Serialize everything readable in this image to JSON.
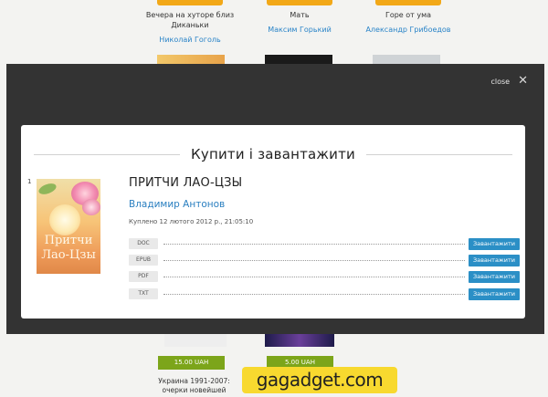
{
  "background": {
    "books_top": [
      {
        "title": "Вечера на хуторе близ Диканьки",
        "author": "Николай Гоголь"
      },
      {
        "title": "Мать",
        "author": "Максим Горький"
      },
      {
        "title": "Горе от ума",
        "author": "Александр Грибоедов"
      }
    ],
    "prices": [
      "15.00 UAH",
      "5.00 UAH"
    ],
    "lower_title": "Украина 1991-2007: очерки новейшей"
  },
  "dialog": {
    "close_label": "close",
    "title": "Купити і завантажити",
    "item_number": "1",
    "cover_title_line1": "Притчи",
    "cover_title_line2": "Лао-Цзы",
    "book_title": "ПРИТЧИ ЛАО-ЦЗЫ",
    "book_author": "Владимир Антонов",
    "purchased": "Куплено 12 лютого 2012 р., 21:05:10",
    "formats": [
      {
        "format": "DOC",
        "button": "Завантажити"
      },
      {
        "format": "EPUB",
        "button": "Завантажити"
      },
      {
        "format": "PDF",
        "button": "Завантажити"
      },
      {
        "format": "TXT",
        "button": "Завантажити"
      }
    ]
  },
  "watermark": "gagadget.com",
  "colors": {
    "accent_blue": "#2b8fc6",
    "overlay": "#333333",
    "price_green": "#7ca51a",
    "tab_orange": "#f2a818"
  }
}
